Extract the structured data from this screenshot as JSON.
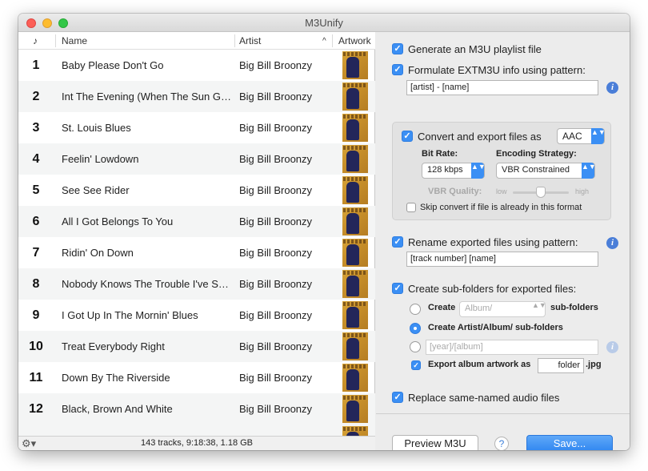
{
  "window": {
    "title": "M3Unify"
  },
  "list": {
    "headers": {
      "note": "♪",
      "name": "Name",
      "artist": "Artist",
      "sort_indicator": "^",
      "artwork": "Artwork"
    },
    "rows": [
      {
        "num": "1",
        "name": "Baby Please Don't Go",
        "artist": "Big Bill Broonzy"
      },
      {
        "num": "2",
        "name": "Int The Evening (When The Sun Go...",
        "artist": "Big Bill Broonzy"
      },
      {
        "num": "3",
        "name": "St. Louis Blues",
        "artist": "Big Bill Broonzy"
      },
      {
        "num": "4",
        "name": "Feelin' Lowdown",
        "artist": "Big Bill Broonzy"
      },
      {
        "num": "5",
        "name": "See See Rider",
        "artist": "Big Bill Broonzy"
      },
      {
        "num": "6",
        "name": "All I Got Belongs To You",
        "artist": "Big Bill Broonzy"
      },
      {
        "num": "7",
        "name": "Ridin' On Down",
        "artist": "Big Bill Broonzy"
      },
      {
        "num": "8",
        "name": "Nobody Knows The Trouble I've Seen",
        "artist": "Big Bill Broonzy"
      },
      {
        "num": "9",
        "name": "I Got Up In The Mornin' Blues",
        "artist": "Big Bill Broonzy"
      },
      {
        "num": "10",
        "name": "Treat Everybody Right",
        "artist": "Big Bill Broonzy"
      },
      {
        "num": "11",
        "name": "Down By The Riverside",
        "artist": "Big Bill Broonzy"
      },
      {
        "num": "12",
        "name": "Black, Brown And White",
        "artist": "Big Bill Broonzy"
      }
    ],
    "status": "143 tracks, 9:18:38, 1.18 GB",
    "gear_icon": "⚙▾"
  },
  "options": {
    "generate_m3u": {
      "label": "Generate an M3U playlist file",
      "checked": true
    },
    "extm3u": {
      "label": "Formulate EXTM3U info using pattern:",
      "checked": true,
      "pattern": "[artist] - [name]"
    },
    "convert": {
      "label": "Convert and export files as",
      "checked": true,
      "format": "AAC",
      "bitrate_label": "Bit Rate:",
      "bitrate": "128 kbps",
      "strategy_label": "Encoding Strategy:",
      "strategy": "VBR Constrained",
      "vbr_label": "VBR Quality:",
      "vbr_low": "low",
      "vbr_high": "high",
      "skip_label": "Skip convert if file is already in this format",
      "skip_checked": false
    },
    "rename": {
      "label": "Rename exported files using pattern:",
      "checked": true,
      "pattern": "[track number] [name]"
    },
    "subfolders": {
      "label": "Create sub-folders for exported files:",
      "checked": true,
      "opt1_create": "Create",
      "opt1_popup": "Album/",
      "opt1_suffix": "sub-folders",
      "opt2_label": "Create Artist/Album/ sub-folders",
      "opt3_pattern": "[year]/[album]",
      "artwork_label": "Export album artwork as",
      "artwork_name": "folder",
      "artwork_ext": ".jpg",
      "artwork_checked": true
    },
    "replace": {
      "label": "Replace same-named audio files",
      "checked": true
    }
  },
  "buttons": {
    "preview": "Preview M3U",
    "help": "?",
    "save": "Save..."
  },
  "icons": {
    "info": "i",
    "check": "✓",
    "arrows": "▲▼"
  }
}
